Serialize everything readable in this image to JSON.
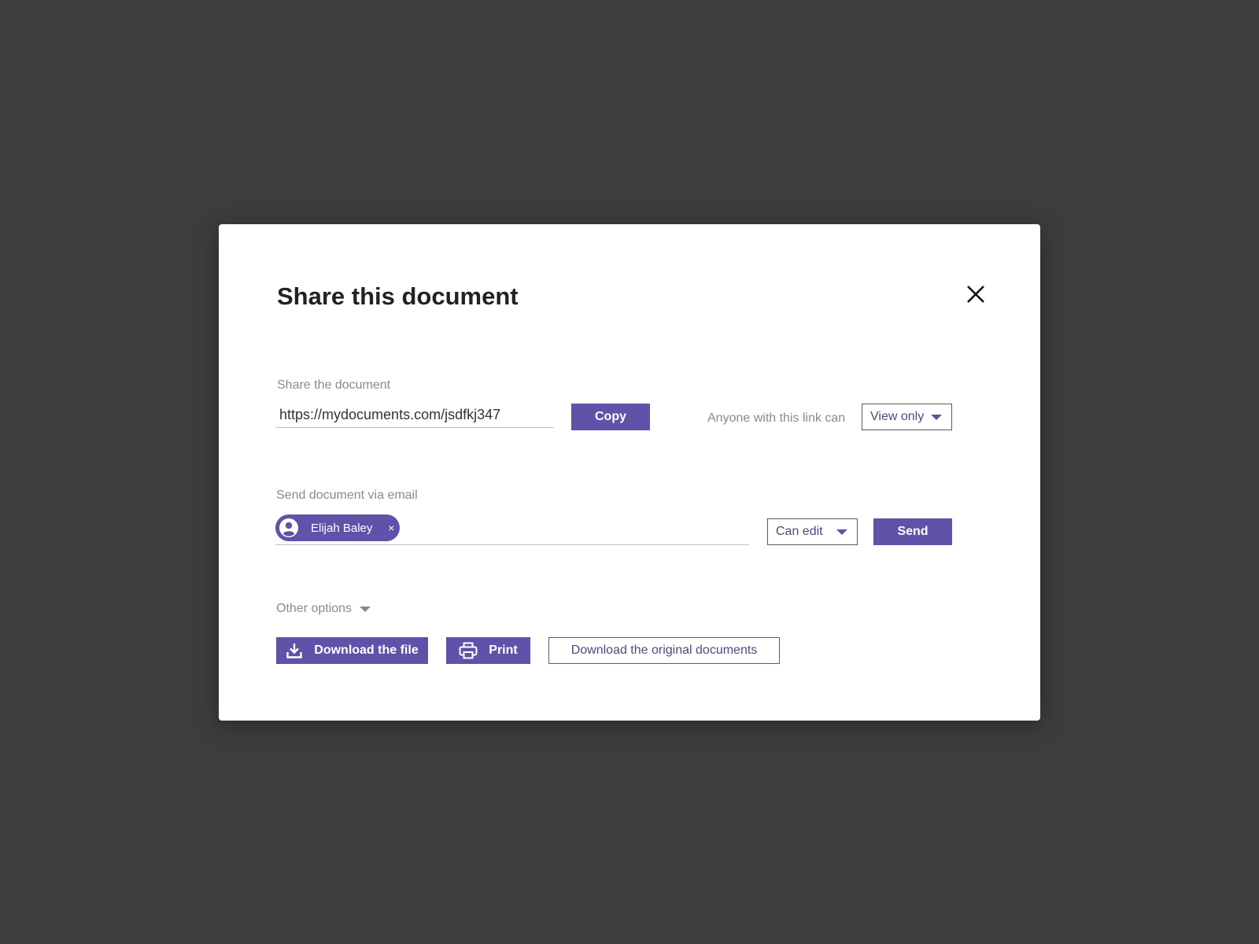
{
  "dialog": {
    "title": "Share this document",
    "close_icon": "close-icon"
  },
  "share_link": {
    "section_label": "Share the document",
    "url_value": "https://mydocuments.com/jsdfkj347",
    "copy_label": "Copy",
    "permission_label": "Anyone with this link can",
    "permission_value": "View only"
  },
  "email": {
    "section_label": "Send document via email",
    "recipients": [
      {
        "name": "Elijah Baley",
        "icon": "user-circle-icon",
        "remove_symbol": "×"
      }
    ],
    "permission_value": "Can edit",
    "send_label": "Send"
  },
  "other_options": {
    "label": "Other options",
    "download_file_label": "Download the file",
    "download_file_icon": "download-icon",
    "print_label": "Print",
    "print_icon": "printer-icon",
    "download_original_label": "Download the original documents"
  },
  "colors": {
    "accent": "#5f52a8",
    "backdrop": "#3d3d3d",
    "muted_text": "#8a8a8a"
  }
}
